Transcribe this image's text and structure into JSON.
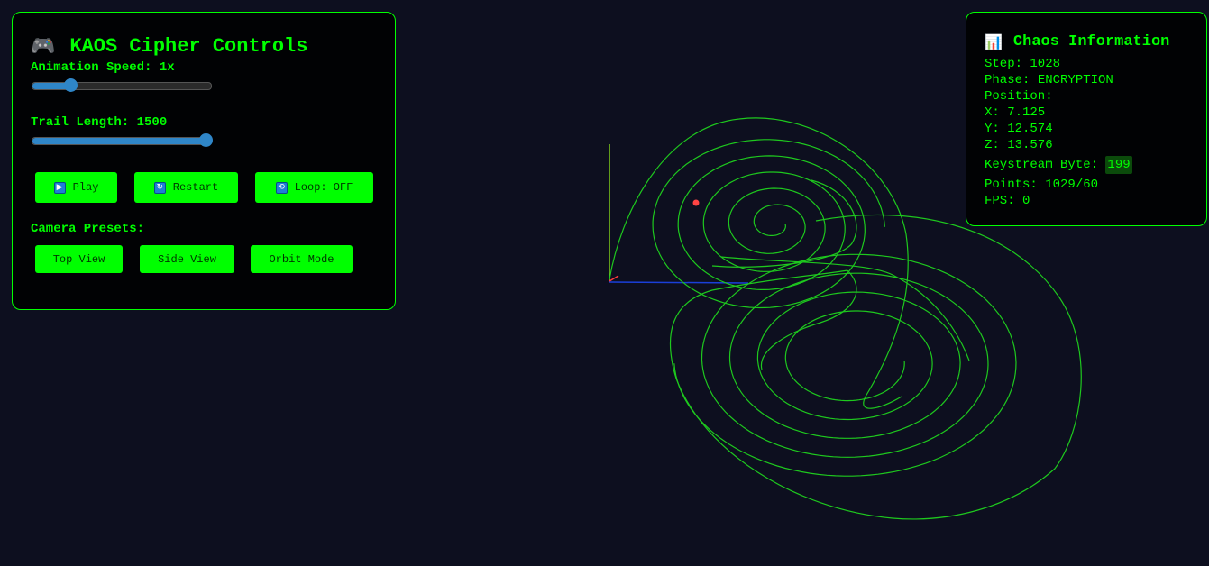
{
  "controls": {
    "title": "KAOS Cipher Controls",
    "title_icon": "gamepad-icon",
    "speed_label": "Animation Speed: 1x",
    "speed_fraction": 0.21,
    "trail_label": "Trail Length: 1500",
    "trail_fraction": 0.97,
    "buttons": {
      "play": "Play",
      "restart": "Restart",
      "loop": "Loop: OFF"
    },
    "camera_label": "Camera Presets:",
    "camera_buttons": {
      "top": "Top View",
      "side": "Side View",
      "orbit": "Orbit Mode"
    }
  },
  "info": {
    "title": "Chaos Information",
    "title_icon": "bar-chart-icon",
    "step": "Step: 1028",
    "phase_label": "Phase: ",
    "phase_value": "ENCRYPTION",
    "position_label": "Position:",
    "x": "X: 7.125",
    "y": "Y: 12.574",
    "z": "Z: 13.576",
    "keystream_label": "Keystream Byte: ",
    "keystream_value": "199",
    "points": "Points: 1029/60",
    "fps": "FPS: 0"
  },
  "colors": {
    "background": "#0d0f1f",
    "accent": "#00ff00",
    "slider": "#2f86c8",
    "marker": "#ff3b3b"
  }
}
